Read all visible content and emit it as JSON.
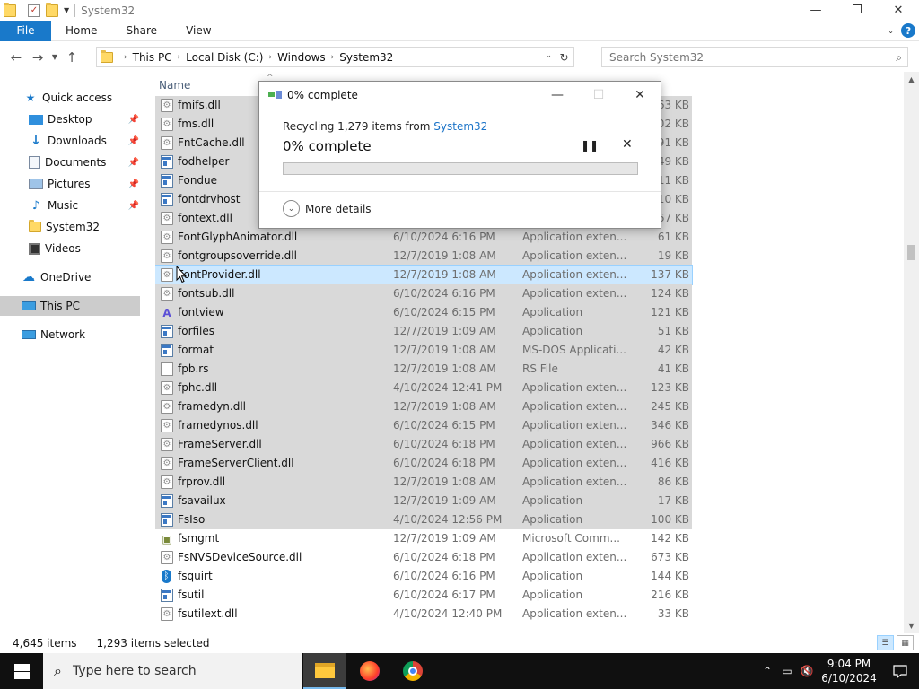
{
  "window": {
    "title": "System32",
    "controls": {
      "minimize": "—",
      "maximize": "❐",
      "close": "✕"
    }
  },
  "ribbon": {
    "file_tab": "File",
    "tabs": [
      "Home",
      "Share",
      "View"
    ]
  },
  "address": {
    "crumbs": [
      "This PC",
      "Local Disk (C:)",
      "Windows",
      "System32"
    ]
  },
  "search": {
    "placeholder": "Search System32"
  },
  "nav": {
    "items": [
      {
        "label": "Quick access",
        "icon": "star-icon"
      },
      {
        "label": "Desktop",
        "icon": "desktop-icon",
        "pinned": true
      },
      {
        "label": "Downloads",
        "icon": "download-icon",
        "pinned": true
      },
      {
        "label": "Documents",
        "icon": "documents-icon",
        "pinned": true
      },
      {
        "label": "Pictures",
        "icon": "pictures-icon",
        "pinned": true
      },
      {
        "label": "Music",
        "icon": "music-icon",
        "pinned": true
      },
      {
        "label": "System32",
        "icon": "folder-icon"
      },
      {
        "label": "Videos",
        "icon": "videos-icon"
      },
      {
        "label": "OneDrive",
        "icon": "cloud-icon"
      },
      {
        "label": "This PC",
        "icon": "computer-icon"
      },
      {
        "label": "Network",
        "icon": "network-icon"
      }
    ]
  },
  "columns": {
    "name": "Name"
  },
  "files": [
    {
      "name": "fmifs.dll",
      "date": "",
      "type": "",
      "size": "63 KB",
      "icon": "dll"
    },
    {
      "name": "fms.dll",
      "date": "",
      "type": "",
      "size": "202 KB",
      "icon": "dll"
    },
    {
      "name": "FntCache.dll",
      "date": "",
      "type": "",
      "size": "391 KB",
      "icon": "dll"
    },
    {
      "name": "fodhelper",
      "date": "",
      "type": "",
      "size": "49 KB",
      "icon": "app"
    },
    {
      "name": "Fondue",
      "date": "",
      "type": "",
      "size": "11 KB",
      "icon": "app"
    },
    {
      "name": "fontdrvhost",
      "date": "",
      "type": "",
      "size": "310 KB",
      "icon": "app"
    },
    {
      "name": "fontext.dll",
      "date": "",
      "type": "",
      "size": "367 KB",
      "icon": "dll"
    },
    {
      "name": "FontGlyphAnimator.dll",
      "date": "6/10/2024 6:16 PM",
      "type": "Application exten...",
      "size": "61 KB",
      "icon": "dll"
    },
    {
      "name": "fontgroupsoverride.dll",
      "date": "12/7/2019 1:08 AM",
      "type": "Application exten...",
      "size": "19 KB",
      "icon": "dll"
    },
    {
      "name": "FontProvider.dll",
      "date": "12/7/2019 1:08 AM",
      "type": "Application exten...",
      "size": "137 KB",
      "icon": "dll"
    },
    {
      "name": "fontsub.dll",
      "date": "6/10/2024 6:16 PM",
      "type": "Application exten...",
      "size": "124 KB",
      "icon": "dll"
    },
    {
      "name": "fontview",
      "date": "6/10/2024 6:15 PM",
      "type": "Application",
      "size": "121 KB",
      "icon": "font"
    },
    {
      "name": "forfiles",
      "date": "12/7/2019 1:09 AM",
      "type": "Application",
      "size": "51 KB",
      "icon": "app"
    },
    {
      "name": "format",
      "date": "12/7/2019 1:08 AM",
      "type": "MS-DOS Applicati...",
      "size": "42 KB",
      "icon": "app"
    },
    {
      "name": "fpb.rs",
      "date": "12/7/2019 1:08 AM",
      "type": "RS File",
      "size": "41 KB",
      "icon": "rs"
    },
    {
      "name": "fphc.dll",
      "date": "4/10/2024 12:41 PM",
      "type": "Application exten...",
      "size": "123 KB",
      "icon": "dll"
    },
    {
      "name": "framedyn.dll",
      "date": "12/7/2019 1:08 AM",
      "type": "Application exten...",
      "size": "245 KB",
      "icon": "dll"
    },
    {
      "name": "framedynos.dll",
      "date": "6/10/2024 6:15 PM",
      "type": "Application exten...",
      "size": "346 KB",
      "icon": "dll"
    },
    {
      "name": "FrameServer.dll",
      "date": "6/10/2024 6:18 PM",
      "type": "Application exten...",
      "size": "966 KB",
      "icon": "dll"
    },
    {
      "name": "FrameServerClient.dll",
      "date": "6/10/2024 6:18 PM",
      "type": "Application exten...",
      "size": "416 KB",
      "icon": "dll"
    },
    {
      "name": "frprov.dll",
      "date": "12/7/2019 1:08 AM",
      "type": "Application exten...",
      "size": "86 KB",
      "icon": "dll"
    },
    {
      "name": "fsavailux",
      "date": "12/7/2019 1:09 AM",
      "type": "Application",
      "size": "17 KB",
      "icon": "app"
    },
    {
      "name": "FsIso",
      "date": "4/10/2024 12:56 PM",
      "type": "Application",
      "size": "100 KB",
      "icon": "app"
    },
    {
      "name": "fsmgmt",
      "date": "12/7/2019 1:09 AM",
      "type": "Microsoft Comm...",
      "size": "142 KB",
      "icon": "mmc"
    },
    {
      "name": "FsNVSDeviceSource.dll",
      "date": "6/10/2024 6:18 PM",
      "type": "Application exten...",
      "size": "673 KB",
      "icon": "dll"
    },
    {
      "name": "fsquirt",
      "date": "6/10/2024 6:16 PM",
      "type": "Application",
      "size": "144 KB",
      "icon": "bt"
    },
    {
      "name": "fsutil",
      "date": "6/10/2024 6:17 PM",
      "type": "Application",
      "size": "216 KB",
      "icon": "app"
    },
    {
      "name": "fsutilext.dll",
      "date": "4/10/2024 12:40 PM",
      "type": "Application exten...",
      "size": "33 KB",
      "icon": "dll"
    }
  ],
  "status": {
    "count": "4,645 items",
    "selected": "1,293 items selected"
  },
  "dialog": {
    "title": "0% complete",
    "recycling_prefix": "Recycling 1,279 items from ",
    "recycling_link": "System32",
    "big_text": "0% complete",
    "progress": 0,
    "more_details": "More details",
    "pause_glyph": "❚❚",
    "stop_glyph": "✕"
  },
  "taskbar": {
    "search_placeholder": "Type here to search",
    "time": "9:04 PM",
    "date": "6/10/2024"
  },
  "colors": {
    "accent": "#1979ca",
    "selection": "#cce8ff",
    "taskbar": "#101010"
  }
}
